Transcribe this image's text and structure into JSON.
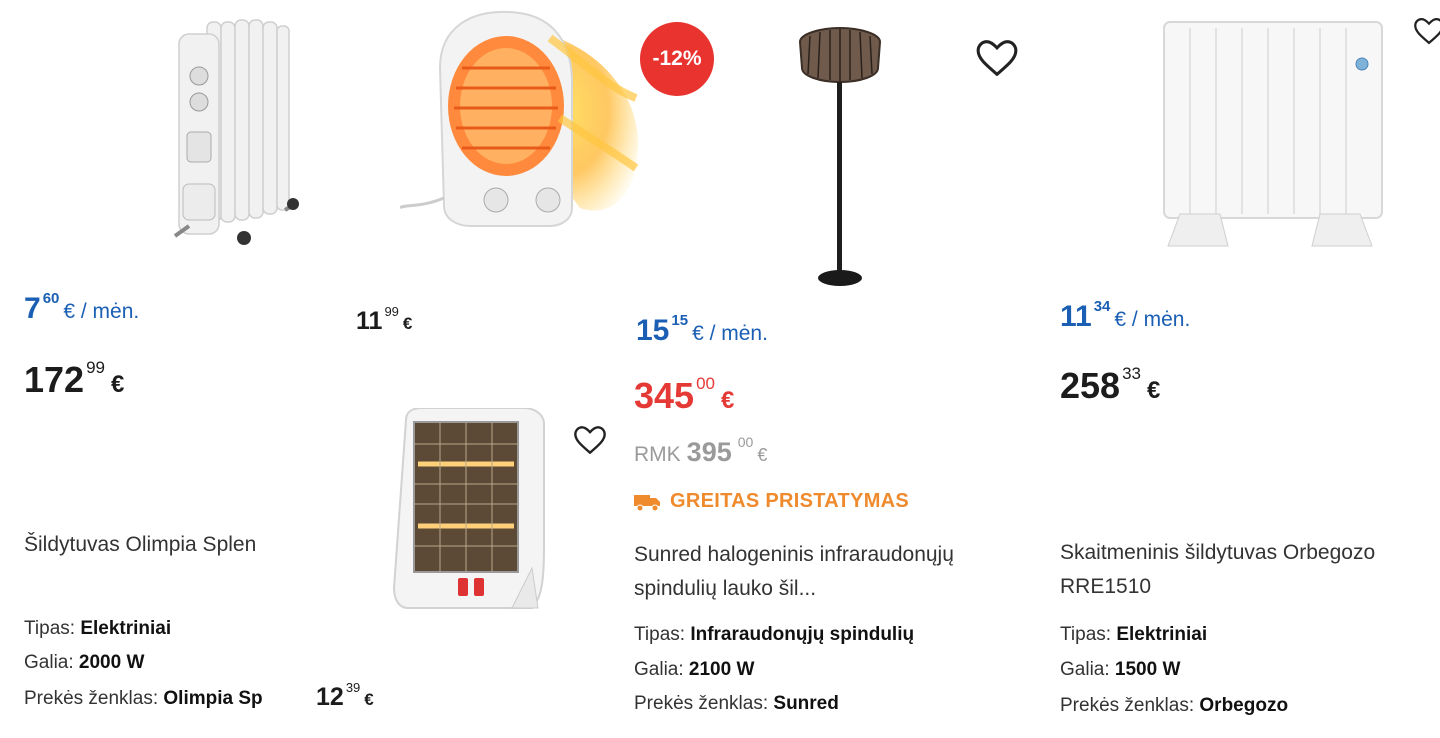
{
  "products": [
    {
      "monthly_int": "7",
      "monthly_dec": "60",
      "monthly_unit": "€ / mėn.",
      "price_int": "172",
      "price_dec": "99",
      "currency": "€",
      "title": "Šildytuvas Olimpia Splen",
      "spec_type_label": "Tipas:",
      "spec_type_value": "Elektriniai",
      "spec_power_label": "Galia:",
      "spec_power_value": "2000 W",
      "spec_brand_label": "Prekės ženklas:",
      "spec_brand_value": "Olimpia Sp"
    },
    {
      "price_int": "11",
      "price_dec": "99",
      "currency": "€"
    },
    {
      "price_int": "12",
      "price_dec": "39",
      "currency": "€"
    },
    {
      "badge": "-12%",
      "monthly_int": "15",
      "monthly_dec": "15",
      "monthly_unit": "€ / mėn.",
      "price_int": "345",
      "price_dec": "00",
      "currency": "€",
      "old_label": "RMK",
      "old_int": "395",
      "old_dec": "00",
      "old_currency": "€",
      "delivery": "GREITAS PRISTATYMAS",
      "title": "Sunred halogeninis infraraudonųjų spindulių lauko šil...",
      "spec_type_label": "Tipas:",
      "spec_type_value": "Infraraudonųjų spindulių",
      "spec_power_label": "Galia:",
      "spec_power_value": "2100 W",
      "spec_brand_label": "Prekės ženklas:",
      "spec_brand_value": "Sunred"
    },
    {
      "monthly_int": "11",
      "monthly_dec": "34",
      "monthly_unit": "€ / mėn.",
      "price_int": "258",
      "price_dec": "33",
      "currency": "€",
      "title": "Skaitmeninis šildytuvas Orbegozo RRE1510",
      "spec_type_label": "Tipas:",
      "spec_type_value": "Elektriniai",
      "spec_power_label": "Galia:",
      "spec_power_value": "1500 W",
      "spec_brand_label": "Prekės ženklas:",
      "spec_brand_value": "Orbegozo"
    }
  ],
  "colors": {
    "monthly": "#1a5fb4",
    "sale": "#e53935",
    "badge": "#e8332f",
    "delivery": "#ef8a2d",
    "old": "#9a9a9a"
  },
  "icons": [
    "heart-icon",
    "truck-icon"
  ]
}
